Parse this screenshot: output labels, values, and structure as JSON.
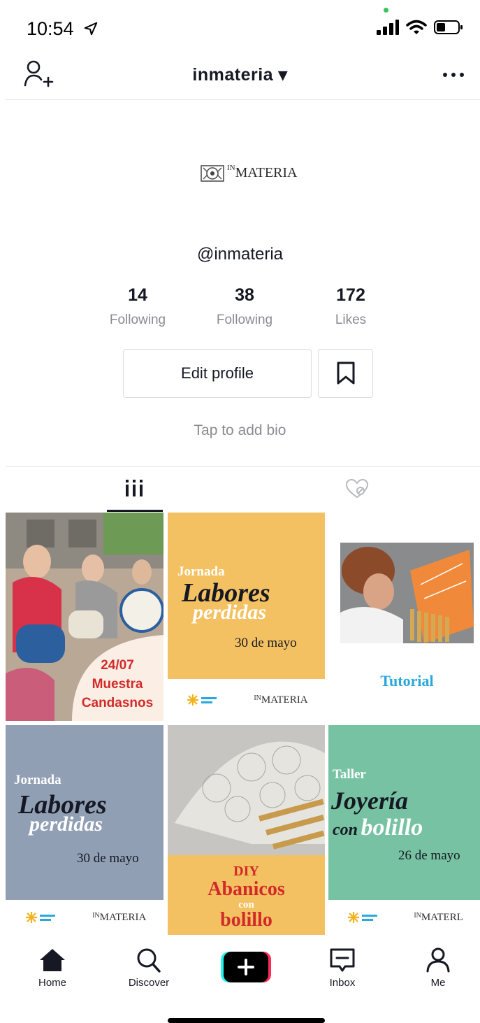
{
  "status": {
    "time": "10:54"
  },
  "header": {
    "title": "inmateria ▾"
  },
  "logo": {
    "prefix": "IN",
    "text": "MATERIA"
  },
  "profile": {
    "username": "@inmateria",
    "bio_placeholder": "Tap to add bio"
  },
  "stats": [
    {
      "value": "14",
      "label": "Following"
    },
    {
      "value": "38",
      "label": "Following"
    },
    {
      "value": "172",
      "label": "Likes"
    }
  ],
  "buttons": {
    "edit_profile": "Edit profile"
  },
  "grid": {
    "tile1": {
      "date": "24/07",
      "line1": "Muestra",
      "line2": "Candasnos"
    },
    "tile2": {
      "jornada": "Jornada",
      "labores": "Labores",
      "perdidas": "perdidas",
      "date": "30 de mayo",
      "logo": "MATERIA"
    },
    "tile3": {
      "label": "Tutorial"
    },
    "tile4": {
      "jornada": "Jornada",
      "labores": "Labores",
      "perdidas": "perdidas",
      "date": "30 de mayo",
      "logo": "MATERIA"
    },
    "tile5": {
      "diy": "DIY",
      "title": "Abanicos",
      "con": "con",
      "bolillo": "bolillo"
    },
    "tile6": {
      "taller": "Taller",
      "joyeria": "Joyería",
      "con": "con",
      "bolillo": "bolillo",
      "date": "26 de mayo",
      "logo": "MATERL"
    }
  },
  "nav": {
    "home": "Home",
    "discover": "Discover",
    "inbox": "Inbox",
    "me": "Me"
  },
  "colors": {
    "accent_red": "#d22a2a",
    "tutorial_blue": "#2aa8dd",
    "create_cyan": "#25f4ee",
    "create_pink": "#fe2c55"
  }
}
